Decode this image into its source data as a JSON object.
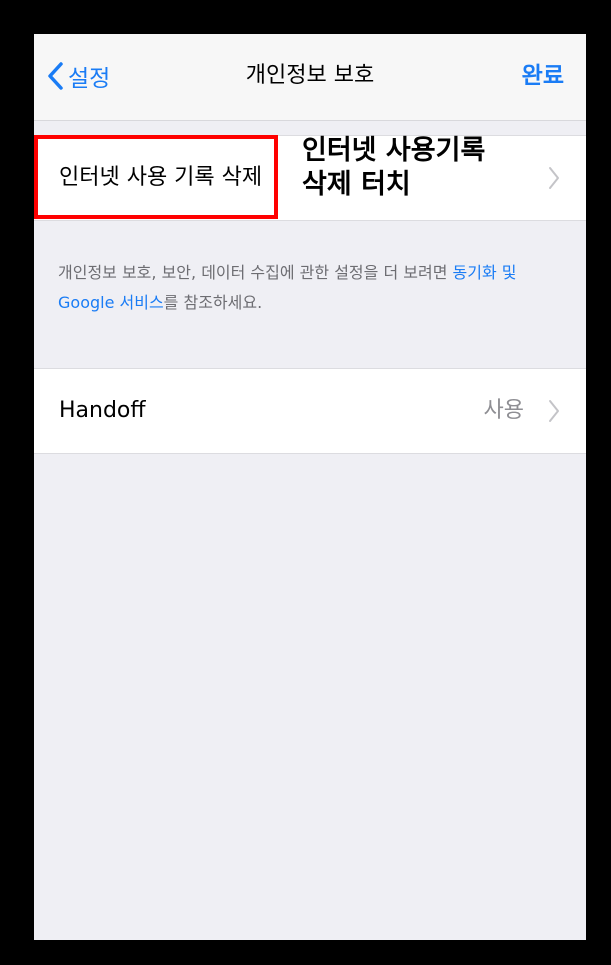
{
  "nav": {
    "back_label": "설정",
    "title": "개인정보 보호",
    "done_label": "완료"
  },
  "rows": {
    "clear_history": {
      "label": "인터넷 사용 기록 삭제"
    },
    "handoff": {
      "label": "Handoff",
      "value": "사용"
    }
  },
  "footer": {
    "text_before": "개인정보 보호, 보안, 데이터 수집에 관한 설정을 더 보려면 ",
    "link": "동기화 및 Google 서비스",
    "text_after": "를 참조하세요."
  },
  "annotation": {
    "line1": "인터넷 사용기록",
    "line2": "삭제 터치"
  },
  "colors": {
    "accent": "#1a7cf5",
    "highlight": "#ff0000",
    "background": "#efeff4"
  },
  "icons": [
    "chevron-left-icon",
    "chevron-right-icon"
  ]
}
